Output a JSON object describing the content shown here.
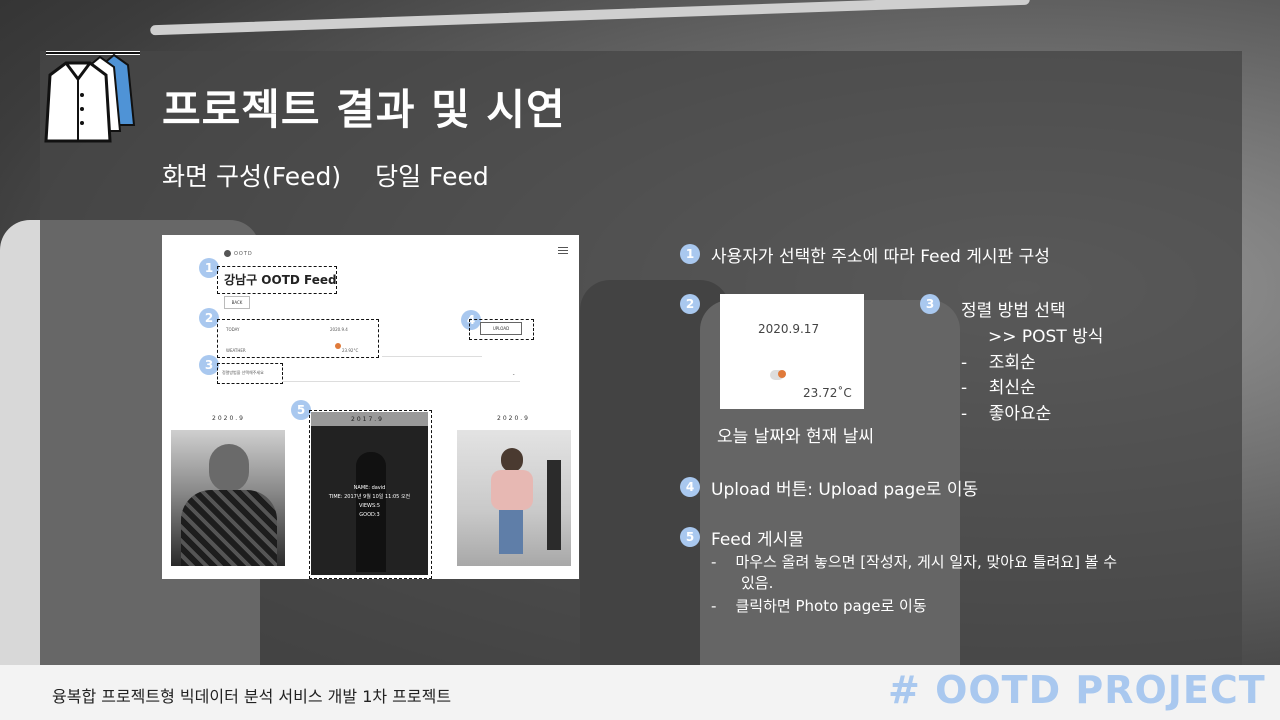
{
  "header": {
    "title": "프로젝트 결과 및 시연",
    "subtitle_left": "화면 구성(Feed)",
    "subtitle_right": "당일 Feed"
  },
  "screenshot": {
    "brand": "OOTD",
    "feed_title": "강남구 OOTD Feed",
    "back_label": "BACK",
    "today_label": "TODAY",
    "today_value": "2020.9.4",
    "weather_label": "WEATHER",
    "weather_value": "23.92°C",
    "sort_placeholder": "정렬방법을 선택해주세요",
    "upload_label": "UPLOAD",
    "post_years": [
      "2020.9",
      "2017.9",
      "2020.9"
    ],
    "hover": {
      "name": "NAME: david",
      "time": "TIME: 2017년 9월 10일 11:05 오전",
      "views": "VIEWS:5",
      "good": "GOOD:3"
    },
    "markers": [
      "1",
      "2",
      "3",
      "4",
      "5"
    ]
  },
  "notes": {
    "n1": {
      "num": "1",
      "text": "사용자가 선택한 주소에 따라 Feed 게시판 구성"
    },
    "n2": {
      "num": "2",
      "date": "2020.9.17",
      "temp": "23.72˚C",
      "caption": "오늘 날짜와 현재 날씨"
    },
    "n3": {
      "num": "3",
      "title": "정렬 방법 선택",
      "sub": ">> POST 방식",
      "items": [
        "조회순",
        "최신순",
        "좋아요순"
      ]
    },
    "n4": {
      "num": "4",
      "text": "Upload 버튼: Upload page로 이동"
    },
    "n5": {
      "num": "5",
      "title": "Feed 게시물",
      "bullet1_line1": "마우스 올려 놓으면 [작성자, 게시 일자, 맞아요 틀려요] 볼 수",
      "bullet1_line2": "있음.",
      "bullet2": "클릭하면 Photo page로 이동"
    }
  },
  "footer": {
    "text": "융복합 프로젝트형 빅데이터 분석 서비스 개발 1차 프로젝트",
    "brand": "# OOTD PROJECT"
  },
  "colors": {
    "accent": "#a9c8ef",
    "panel": "#464646",
    "footer": "#f3f3f3"
  }
}
